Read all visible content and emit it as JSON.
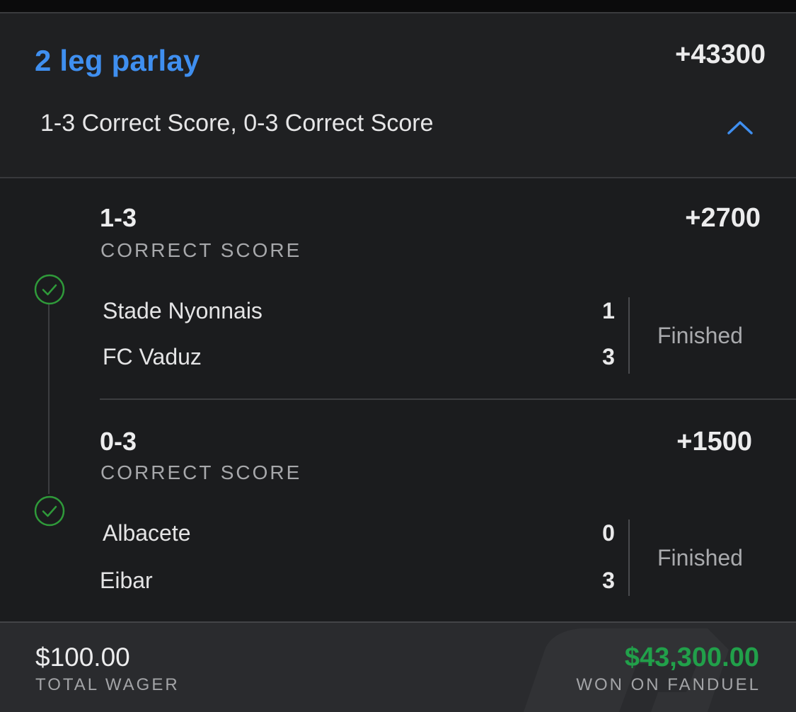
{
  "parlay": {
    "title": "2 leg parlay",
    "odds": "+43300",
    "subtitle": "1-3 Correct Score, 0-3 Correct Score"
  },
  "legs": [
    {
      "score": "1-3",
      "market": "CORRECT SCORE",
      "odds": "+2700",
      "teams": [
        {
          "name": "Stade Nyonnais",
          "score": "1"
        },
        {
          "name": "FC Vaduz",
          "score": "3"
        }
      ],
      "status": "Finished"
    },
    {
      "score": "0-3",
      "market": "CORRECT SCORE",
      "odds": "+1500",
      "teams": [
        {
          "name": "Albacete",
          "score": "0"
        },
        {
          "name": "Eibar",
          "score": "3"
        }
      ],
      "status": "Finished"
    }
  ],
  "footer": {
    "wager_amount": "$100.00",
    "wager_label": "TOTAL WAGER",
    "won_amount": "$43,300.00",
    "won_label": "WON ON FANDUEL"
  },
  "colors": {
    "accent_blue": "#3f8ff0",
    "win_green": "#21a04a",
    "check_green": "#2f9a3a"
  },
  "icons": {
    "collapse": "chevron-up-icon",
    "leg_status": "check-circle-icon"
  }
}
